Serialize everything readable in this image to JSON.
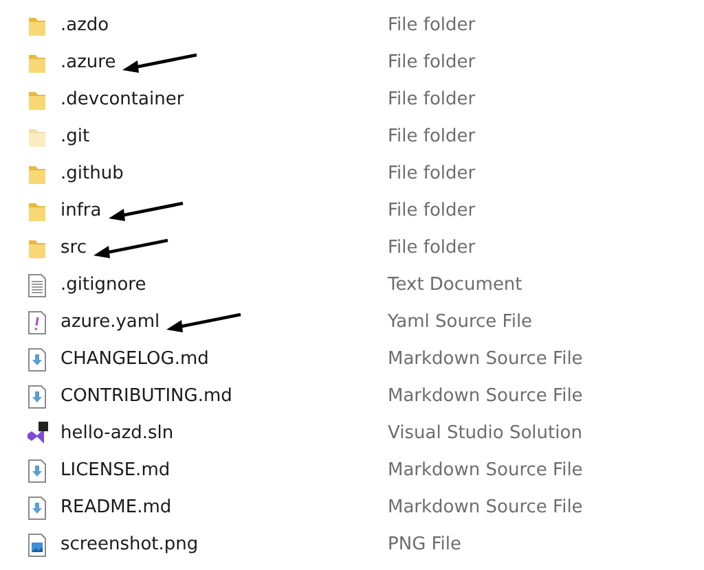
{
  "files": [
    {
      "name": ".azdo",
      "type": "File folder",
      "kind": "folder",
      "hidden": false,
      "arrow": false
    },
    {
      "name": ".azure",
      "type": "File folder",
      "kind": "folder",
      "hidden": false,
      "arrow": true
    },
    {
      "name": ".devcontainer",
      "type": "File folder",
      "kind": "folder",
      "hidden": false,
      "arrow": false
    },
    {
      "name": ".git",
      "type": "File folder",
      "kind": "folder",
      "hidden": true,
      "arrow": false
    },
    {
      "name": ".github",
      "type": "File folder",
      "kind": "folder",
      "hidden": false,
      "arrow": false
    },
    {
      "name": "infra",
      "type": "File folder",
      "kind": "folder",
      "hidden": false,
      "arrow": true
    },
    {
      "name": "src",
      "type": "File folder",
      "kind": "folder",
      "hidden": false,
      "arrow": true
    },
    {
      "name": ".gitignore",
      "type": "Text Document",
      "kind": "text",
      "hidden": false,
      "arrow": false
    },
    {
      "name": "azure.yaml",
      "type": "Yaml Source File",
      "kind": "yaml",
      "hidden": false,
      "arrow": true
    },
    {
      "name": "CHANGELOG.md",
      "type": "Markdown Source File",
      "kind": "markdown",
      "hidden": false,
      "arrow": false
    },
    {
      "name": "CONTRIBUTING.md",
      "type": "Markdown Source File",
      "kind": "markdown",
      "hidden": false,
      "arrow": false
    },
    {
      "name": "hello-azd.sln",
      "type": "Visual Studio Solution",
      "kind": "solution",
      "hidden": false,
      "arrow": false
    },
    {
      "name": "LICENSE.md",
      "type": "Markdown Source File",
      "kind": "markdown",
      "hidden": false,
      "arrow": false
    },
    {
      "name": "README.md",
      "type": "Markdown Source File",
      "kind": "markdown",
      "hidden": false,
      "arrow": false
    },
    {
      "name": "screenshot.png",
      "type": "PNG File",
      "kind": "image",
      "hidden": false,
      "arrow": false
    }
  ]
}
